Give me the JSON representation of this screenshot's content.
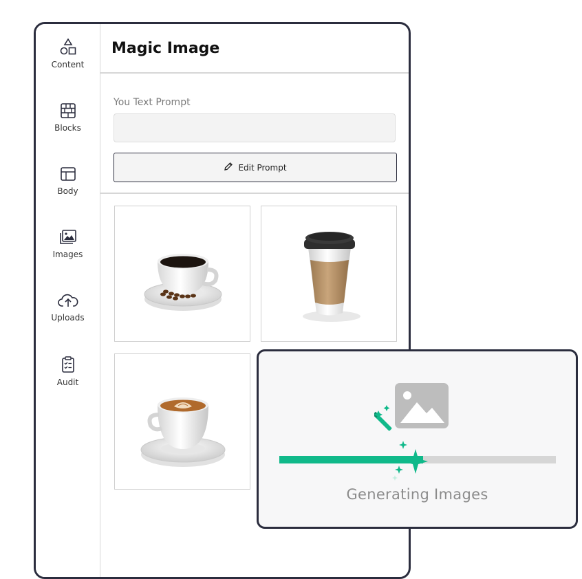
{
  "sidebar": {
    "items": [
      {
        "label": "Content",
        "icon": "shapes-icon"
      },
      {
        "label": "Blocks",
        "icon": "blocks-icon"
      },
      {
        "label": "Body",
        "icon": "layout-icon"
      },
      {
        "label": "Images",
        "icon": "images-icon"
      },
      {
        "label": "Uploads",
        "icon": "cloud-upload-icon"
      },
      {
        "label": "Audit",
        "icon": "clipboard-icon"
      }
    ]
  },
  "header": {
    "title": "Magic Image"
  },
  "prompt": {
    "label": "You Text Prompt",
    "value": "",
    "edit_button_label": "Edit Prompt",
    "edit_button_icon": "pencil-icon"
  },
  "gallery": {
    "images": [
      {
        "alt": "black coffee cup on saucer with coffee beans",
        "icon": "coffee-cup-image"
      },
      {
        "alt": "takeaway coffee cup with brown sleeve",
        "icon": "takeaway-cup-image"
      },
      {
        "alt": "latte art cup on saucer",
        "icon": "latte-cup-image"
      }
    ]
  },
  "generating": {
    "text": "Generating Images",
    "progress": 0.52,
    "icon": "magic-wand-image-icon"
  },
  "colors": {
    "accent": "#10b98a",
    "border_dark": "#2b2d3e",
    "track": "#d6d6d6",
    "muted_text": "#8b8b8b"
  }
}
